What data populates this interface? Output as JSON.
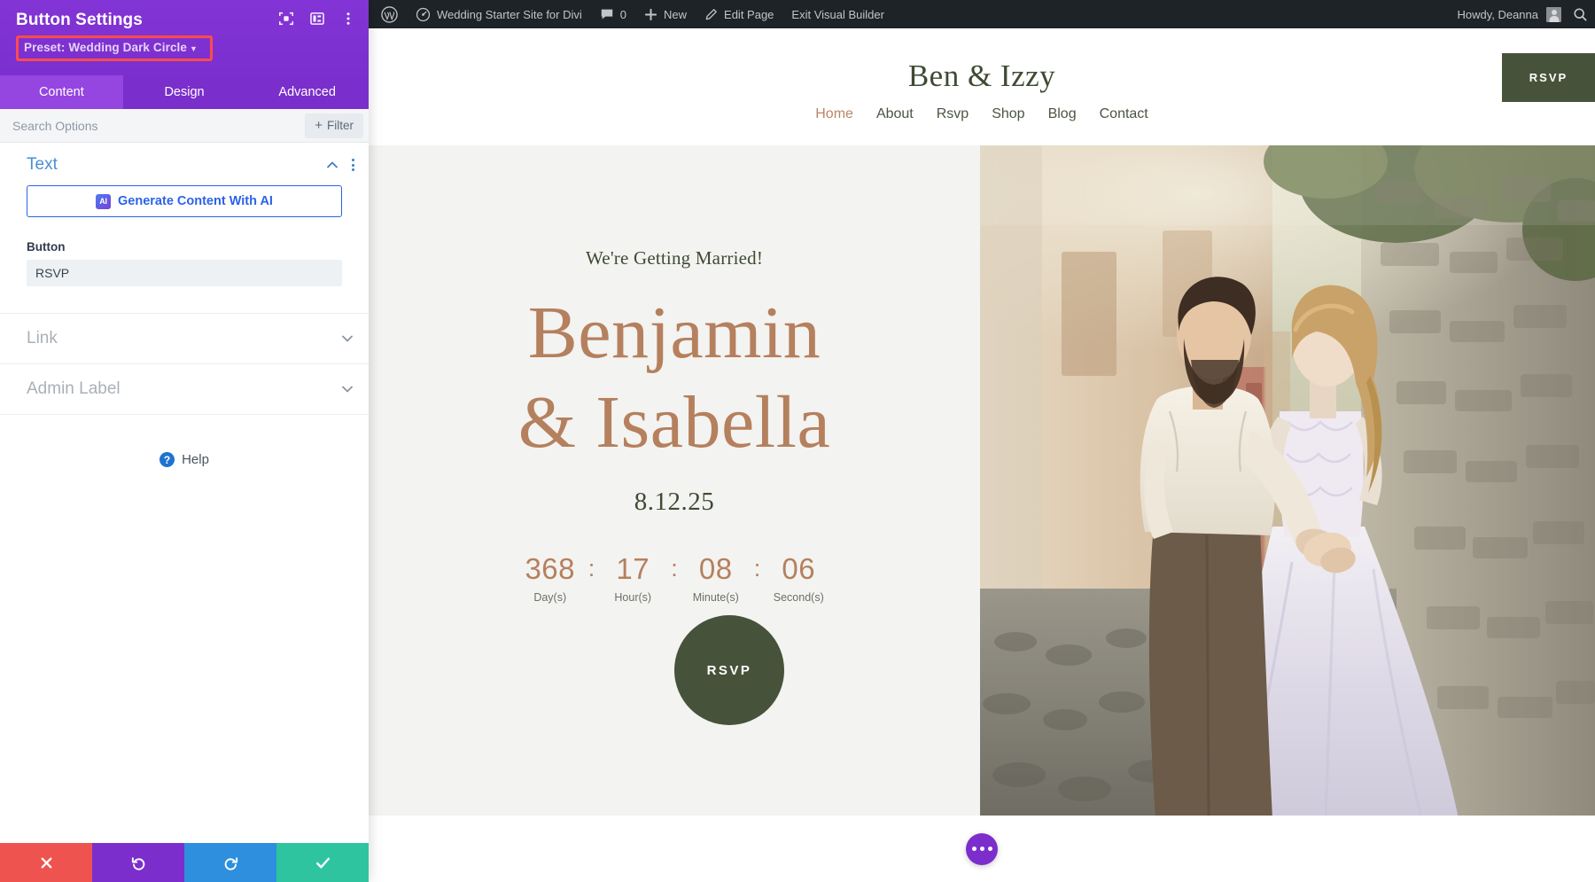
{
  "panel": {
    "title": "Button Settings",
    "preset_label": "Preset: Wedding Dark Circle",
    "header_icons": [
      {
        "name": "focus-target-icon"
      },
      {
        "name": "layout-panel-icon"
      },
      {
        "name": "more-vertical-icon"
      }
    ],
    "tabs": [
      {
        "label": "Content",
        "active": true
      },
      {
        "label": "Design",
        "active": false
      },
      {
        "label": "Advanced",
        "active": false
      }
    ],
    "search": {
      "placeholder": "Search Options",
      "value": ""
    },
    "filter_label": "Filter",
    "sections": {
      "text": {
        "title": "Text",
        "ai_button_label": "Generate Content With AI",
        "ai_badge": "AI",
        "field_label": "Button",
        "field_value": "RSVP"
      },
      "link": {
        "title": "Link"
      },
      "admin_label": {
        "title": "Admin Label"
      }
    },
    "help_label": "Help",
    "actions": [
      {
        "name": "cancel-button",
        "icon": "close-icon",
        "color": "#ef5350"
      },
      {
        "name": "undo-button",
        "icon": "undo-icon",
        "color": "#7b2ecc"
      },
      {
        "name": "redo-button",
        "icon": "redo-icon",
        "color": "#2d8fdd"
      },
      {
        "name": "save-button",
        "icon": "check-icon",
        "color": "#2ec4a0"
      }
    ],
    "colors": {
      "header": "#7b2fce",
      "tab_active": "#9545e0",
      "highlight": "#ff4b4b"
    }
  },
  "adminbar": {
    "wp_logo": "wordpress-icon",
    "site_name": "Wedding Starter Site for Divi",
    "comments_count": "0",
    "new_label": "New",
    "edit_page_label": "Edit Page",
    "exit_builder_label": "Exit Visual Builder",
    "howdy": "Howdy, Deanna",
    "search_icon": "search-icon"
  },
  "site": {
    "logo": "Ben & Izzy",
    "nav": [
      {
        "label": "Home",
        "active": true
      },
      {
        "label": "About",
        "active": false
      },
      {
        "label": "Rsvp",
        "active": false
      },
      {
        "label": "Shop",
        "active": false
      },
      {
        "label": "Blog",
        "active": false
      },
      {
        "label": "Contact",
        "active": false
      }
    ],
    "header_cta": "RSVP",
    "hero": {
      "kicker": "We're Getting Married!",
      "name_line1": "Benjamin",
      "name_line2": "& Isabella",
      "date": "8.12.25",
      "circle_cta": "RSVP",
      "countdown": [
        {
          "value": "368",
          "label": "Day(s)"
        },
        {
          "value": "17",
          "label": "Hour(s)"
        },
        {
          "value": "08",
          "label": "Minute(s)"
        },
        {
          "value": "06",
          "label": "Second(s)"
        }
      ],
      "separator": ":"
    },
    "colors": {
      "accent_rose": "#b5805e",
      "dark_green": "#47523a",
      "bg": "#f3f3f1"
    }
  }
}
